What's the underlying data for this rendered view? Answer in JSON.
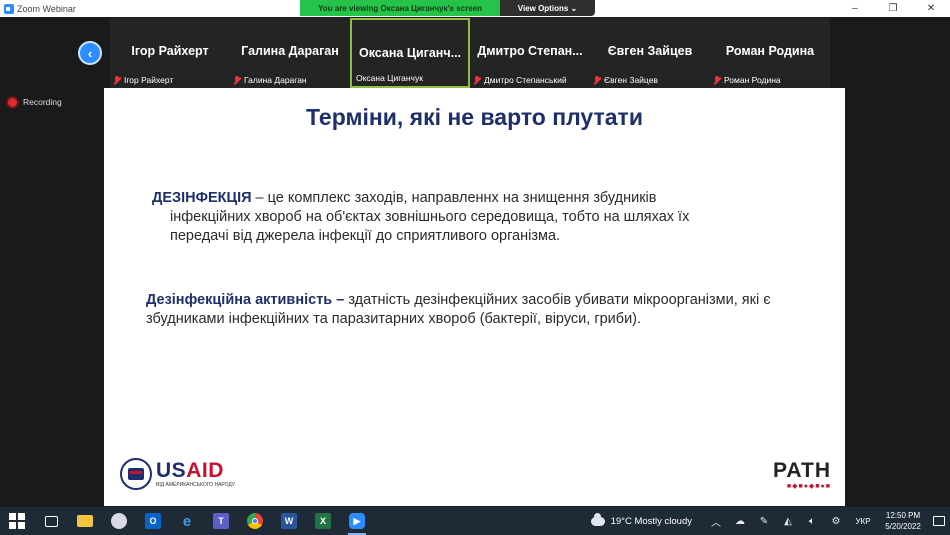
{
  "window": {
    "title": "Zoom Webinar",
    "controls": [
      "–",
      "❐",
      "✕"
    ]
  },
  "banner": {
    "viewing": "You are viewing Оксана Циганчук's screen",
    "options": "View Options ⌄"
  },
  "participants": [
    {
      "display": "Ігор Райхерт",
      "name": "Ігор Райхерт"
    },
    {
      "display": "Галина Дараган",
      "name": "Галина Дараган"
    },
    {
      "display": "Оксана Циганч...",
      "name": "Оксана Циганчук"
    },
    {
      "display": "Дмитро Степан...",
      "name": "Дмитро Степанський"
    },
    {
      "display": "Євген Зайцев",
      "name": "Євген Зайцев"
    },
    {
      "display": "Роман Родина",
      "name": "Роман Родина"
    }
  ],
  "recording": "Recording",
  "slide": {
    "title": "Терміни, які не варто плутати",
    "term1": "ДЕЗІНФЕКЦІЯ",
    "def1_line1": " – це комплекс заходів, направленнх на знищення збудників",
    "def1_line2": "інфекційних хвороб на об'єктах зовнішнього середовища, тобто на шляхах їх",
    "def1_line3": "передачі від джерела інфекції до сприятливого організма.",
    "term2": "Дезінфекційна активність –",
    "def2": " здатність дезінфекційних засобів убивати мікроорганізми, які є збудниками інфекційних та паразитарних хвороб (бактерії, віруси, гриби).",
    "usaid_us": "US",
    "usaid_aid": "AID",
    "usaid_sub": "ВІД АМЕРИКАНСЬКОГО НАРОДУ",
    "path_word": "PATH",
    "path_dots": "■◆■●◆■●■"
  },
  "taskbar": {
    "weather": "19°C  Mostly cloudy",
    "language": "УКР",
    "time": "12:50 PM",
    "date": "5/20/2022",
    "apps": [
      "start",
      "task-view",
      "file-explorer",
      "paint",
      "outlook",
      "internet-explorer",
      "teams",
      "chrome",
      "word",
      "excel",
      "zoom"
    ]
  },
  "colors": {
    "accent": "#2d8cff",
    "banner_green": "#25c34a",
    "slide_title": "#1f2f6b",
    "usaid_red": "#c8102e"
  }
}
